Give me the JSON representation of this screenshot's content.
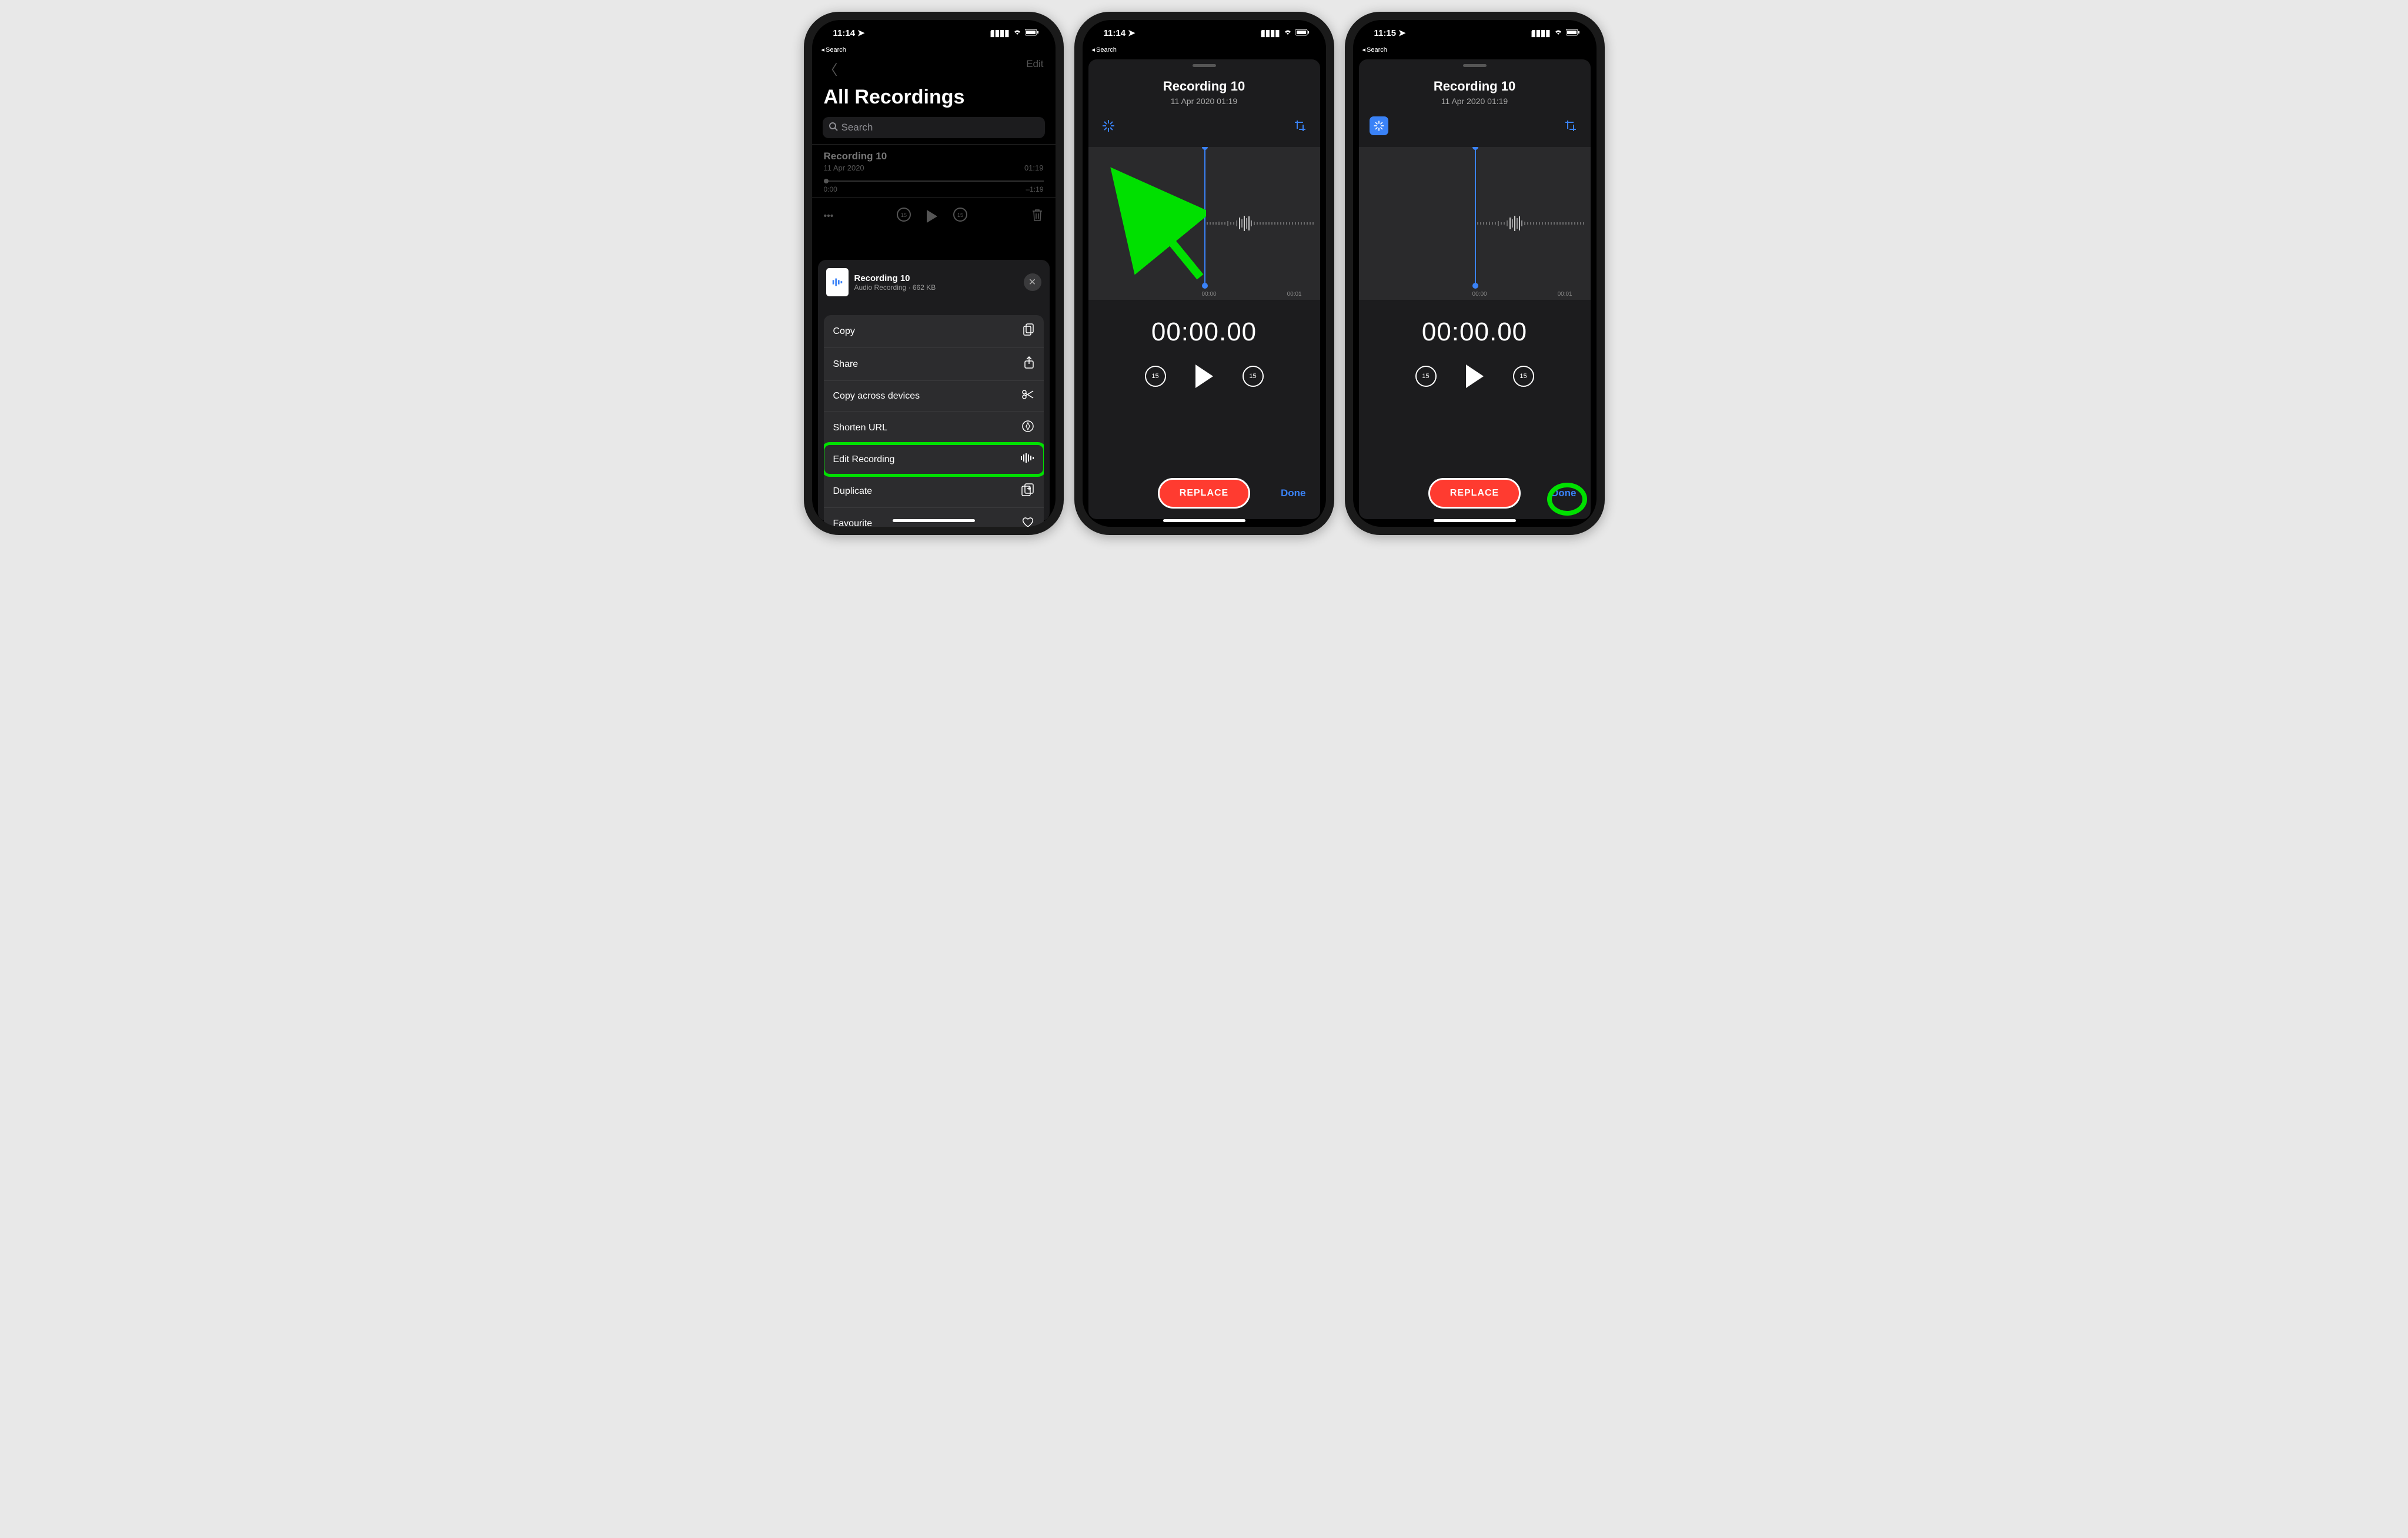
{
  "status": {
    "time1": "11:14",
    "time2": "11:14",
    "time3": "11:15",
    "back_label": "Search"
  },
  "screen1": {
    "edit_label": "Edit",
    "page_title": "All Recordings",
    "search_placeholder": "Search",
    "item": {
      "title": "Recording 10",
      "date": "11 Apr 2020",
      "duration": "01:19",
      "time_start": "0:00",
      "time_end": "–1:19"
    },
    "sheet": {
      "title": "Recording 10",
      "subtitle": "Audio Recording · 662 KB",
      "actions": {
        "copy": "Copy",
        "share": "Share",
        "copy_across": "Copy across devices",
        "shorten_url": "Shorten URL",
        "edit_recording": "Edit Recording",
        "duplicate": "Duplicate",
        "favourite": "Favourite"
      }
    }
  },
  "editor": {
    "title": "Recording 10",
    "subtitle": "11 Apr 2020  01:19",
    "tick1": "00:00",
    "tick2": "00:01",
    "big_time": "00:00.00",
    "skip_back": "15",
    "skip_fwd": "15",
    "replace": "REPLACE",
    "done": "Done"
  }
}
